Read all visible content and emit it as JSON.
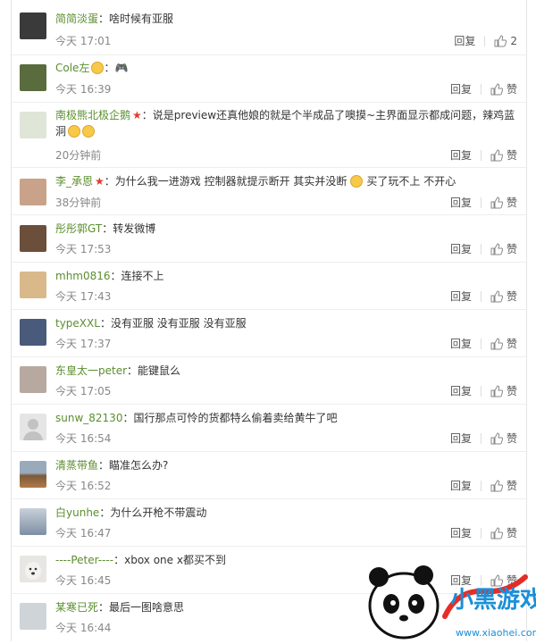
{
  "comments": [
    {
      "user": "简简淡蛋",
      "text": "：啥时候有亚服",
      "time": "今天 17:01",
      "reply": "回复",
      "like": "2",
      "avatar_color": "#3a3a3a",
      "decor": ""
    },
    {
      "user": "Cole左",
      "text": "：",
      "time": "今天 16:39",
      "reply": "回复",
      "like": "赞",
      "avatar_color": "#5a6b3d",
      "decor": "gamepad"
    },
    {
      "user": "南极熊北极企鹅",
      "text": "：说是preview还真他娘的就是个半成品了噢摸~主界面显示都成问题，辣鸡蓝",
      "text2": "洞",
      "time": "20分钟前",
      "reply": "回复",
      "like": "赞",
      "avatar_color": "#dfe6d8",
      "decor": "star"
    },
    {
      "user": "李_承恩",
      "text": "：为什么我一进游戏 控制器就提示断开 其实并没断",
      "text_b": "买了玩不上 不开心",
      "time": "38分钟前",
      "reply": "回复",
      "like": "赞",
      "avatar_color": "#c9a28a",
      "decor": "star"
    },
    {
      "user": "彤彤郭GT",
      "text": "：转发微博",
      "time": "今天 17:53",
      "reply": "回复",
      "like": "赞",
      "avatar_color": "#6b4f3a",
      "decor": ""
    },
    {
      "user": "mhm0816",
      "text": "：连接不上",
      "time": "今天 17:43",
      "reply": "回复",
      "like": "赞",
      "avatar_color": "#d9b98a",
      "decor": ""
    },
    {
      "user": "typeXXL",
      "text": "：没有亚服 没有亚服 没有亚服",
      "time": "今天 17:37",
      "reply": "回复",
      "like": "赞",
      "avatar_color": "#4a5a7a",
      "decor": ""
    },
    {
      "user": "东皇太一peter",
      "text": "：能键鼠么",
      "time": "今天 17:05",
      "reply": "回复",
      "like": "赞",
      "avatar_color": "#b7a9a0",
      "decor": ""
    },
    {
      "user": "sunw_82130",
      "text": "：国行那点可怜的货都特么偷着卖给黄牛了吧",
      "time": "今天 16:54",
      "reply": "回复",
      "like": "赞",
      "avatar_color": "#d5d5d5",
      "decor": ""
    },
    {
      "user": "清蒸带鱼",
      "text": "：瞄准怎么办?",
      "time": "今天 16:52",
      "reply": "回复",
      "like": "赞",
      "avatar_color": "#8a6a4a",
      "decor": ""
    },
    {
      "user": "白yunhe",
      "text": "：为什么开枪不带震动",
      "time": "今天 16:47",
      "reply": "回复",
      "like": "赞",
      "avatar_color": "#7e8fa3",
      "decor": ""
    },
    {
      "user": "----Peter----",
      "text": "：xbox one x都买不到",
      "time": "今天 16:45",
      "reply": "回复",
      "like": "赞",
      "avatar_color": "#e8e6e2",
      "decor": ""
    },
    {
      "user": "某寒已死",
      "text": "：最后一图啥意思",
      "time": "今天 16:44",
      "reply": "回复",
      "like": "赞",
      "avatar_color": "#cfd4d8",
      "decor": ""
    }
  ],
  "watermark": {
    "brand": "小黑游戏",
    "url": "www.xiaohei.com"
  }
}
